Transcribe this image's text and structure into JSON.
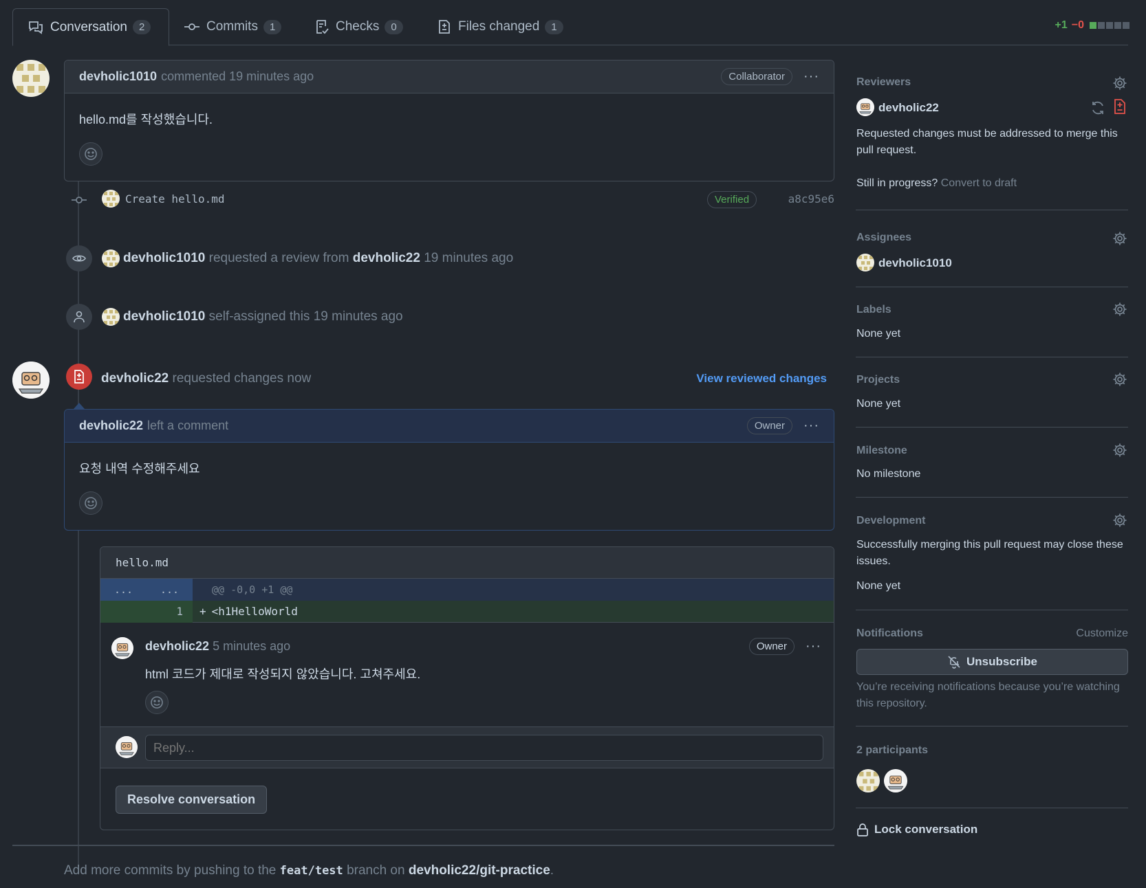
{
  "tabs": [
    {
      "label": "Conversation",
      "count": "2"
    },
    {
      "label": "Commits",
      "count": "1"
    },
    {
      "label": "Checks",
      "count": "0"
    },
    {
      "label": "Files changed",
      "count": "1"
    }
  ],
  "diffstat": {
    "additions": "+1",
    "deletions": "−0"
  },
  "comment1": {
    "author": "devholic1010",
    "action": "commented 19 minutes ago",
    "badge": "Collaborator",
    "body": "hello.md를 작성했습니다."
  },
  "commit": {
    "message": "Create hello.md",
    "verified": "Verified",
    "sha": "a8c95e6"
  },
  "event_review_request": {
    "actor": "devholic1010",
    "text": "requested a review from",
    "target": "devholic22",
    "time": "19 minutes ago"
  },
  "event_assign": {
    "actor": "devholic1010",
    "text": "self-assigned this 19 minutes ago"
  },
  "review": {
    "author": "devholic22",
    "text": "requested changes now",
    "view_link": "View reviewed changes"
  },
  "review_comment": {
    "author": "devholic22",
    "action": "left a comment",
    "badge": "Owner",
    "body": "요청 내역 수정해주세요"
  },
  "diff": {
    "filename": "hello.md",
    "hunk_left": "...",
    "hunk_right": "...",
    "hunk_header": "@@ -0,0 +1 @@",
    "line_number": "1",
    "line_sign": "+",
    "line_code": "<h1HelloWorld"
  },
  "inline_comment": {
    "author": "devholic22",
    "time": "5 minutes ago",
    "badge": "Owner",
    "body": "html 코드가 제대로 작성되지 않았습니다. 고쳐주세요."
  },
  "reply": {
    "placeholder": "Reply..."
  },
  "resolve_button": "Resolve conversation",
  "footer": {
    "prefix": "Add more commits by pushing to the",
    "branch": "feat/test",
    "middle": "branch on",
    "repo": "devholic22/git-practice",
    "suffix": "."
  },
  "sidebar": {
    "reviewers": {
      "title": "Reviewers",
      "name": "devholic22",
      "note": "Requested changes must be addressed to merge this pull request.",
      "progress_q": "Still in progress?",
      "draft_link": "Convert to draft"
    },
    "assignees": {
      "title": "Assignees",
      "name": "devholic1010"
    },
    "labels": {
      "title": "Labels",
      "value": "None yet"
    },
    "projects": {
      "title": "Projects",
      "value": "None yet"
    },
    "milestone": {
      "title": "Milestone",
      "value": "No milestone"
    },
    "development": {
      "title": "Development",
      "note": "Successfully merging this pull request may close these issues.",
      "value": "None yet"
    },
    "notifications": {
      "title": "Notifications",
      "customize": "Customize",
      "button": "Unsubscribe",
      "note": "You’re receiving notifications because you’re watching this repository."
    },
    "participants": {
      "title": "2 participants"
    },
    "lock": "Lock conversation"
  },
  "colors": {
    "bg": "#22272e",
    "accent_blue": "#539bf5",
    "danger": "#e5534b",
    "success": "#57ab5a"
  }
}
